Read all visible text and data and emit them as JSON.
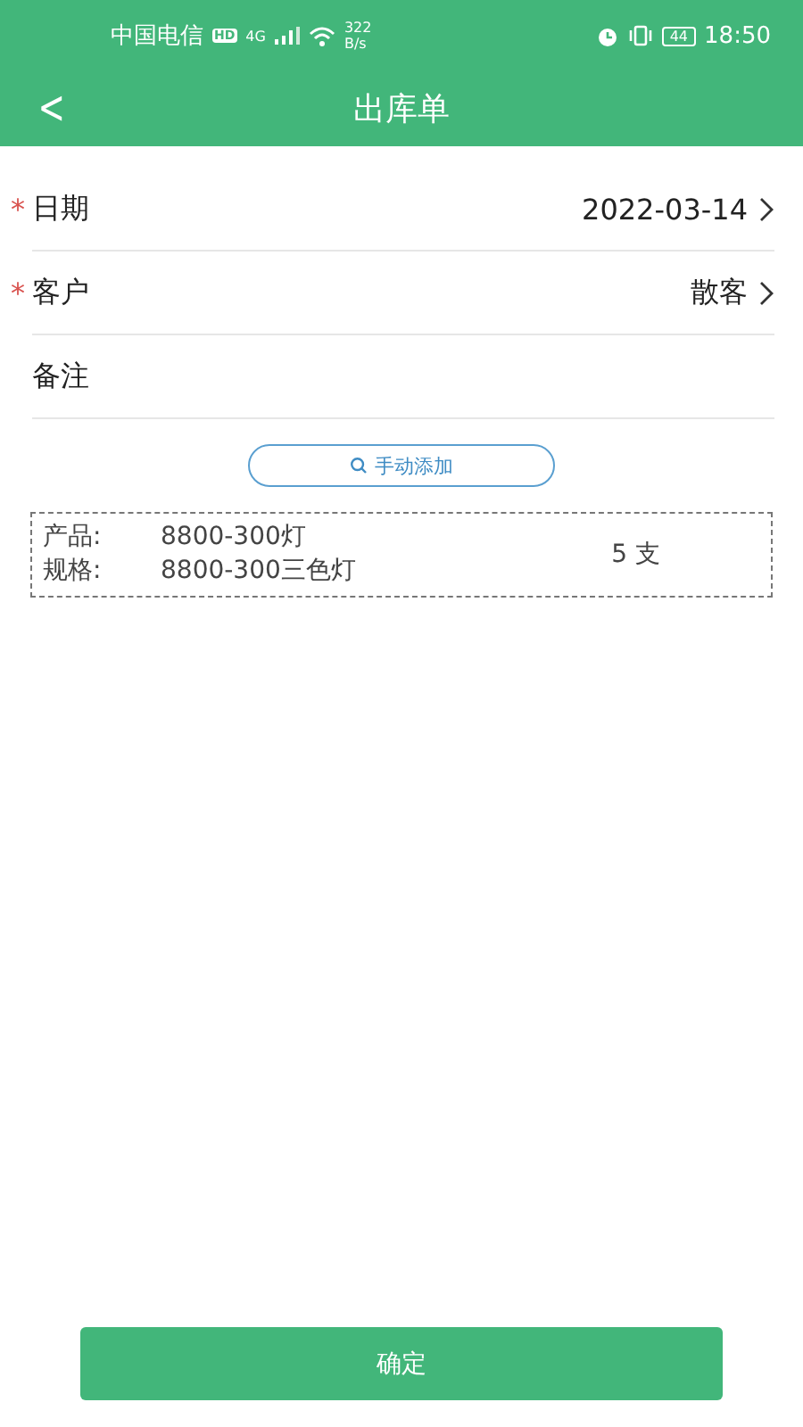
{
  "status_bar": {
    "carrier": "中国电信",
    "hd": "HD",
    "network": "4G",
    "speed": "322",
    "speed_unit": "B/s",
    "battery": "44",
    "time": "18:50"
  },
  "header": {
    "back": "<",
    "title": "出库单"
  },
  "fields": [
    {
      "required_mark": "*",
      "label": "日期",
      "value": "2022-03-14",
      "chevron": true
    },
    {
      "required_mark": "*",
      "label": "客户",
      "value": "散客",
      "chevron": true
    },
    {
      "label": "备注",
      "chevron": false
    }
  ],
  "add_button": "手动添加",
  "items": [
    {
      "product_label": "产品:",
      "product": "8800-300灯",
      "spec_label": "规格:",
      "spec": "8800-300三色灯",
      "quantity": "5 支"
    }
  ],
  "confirm_button": "确定"
}
